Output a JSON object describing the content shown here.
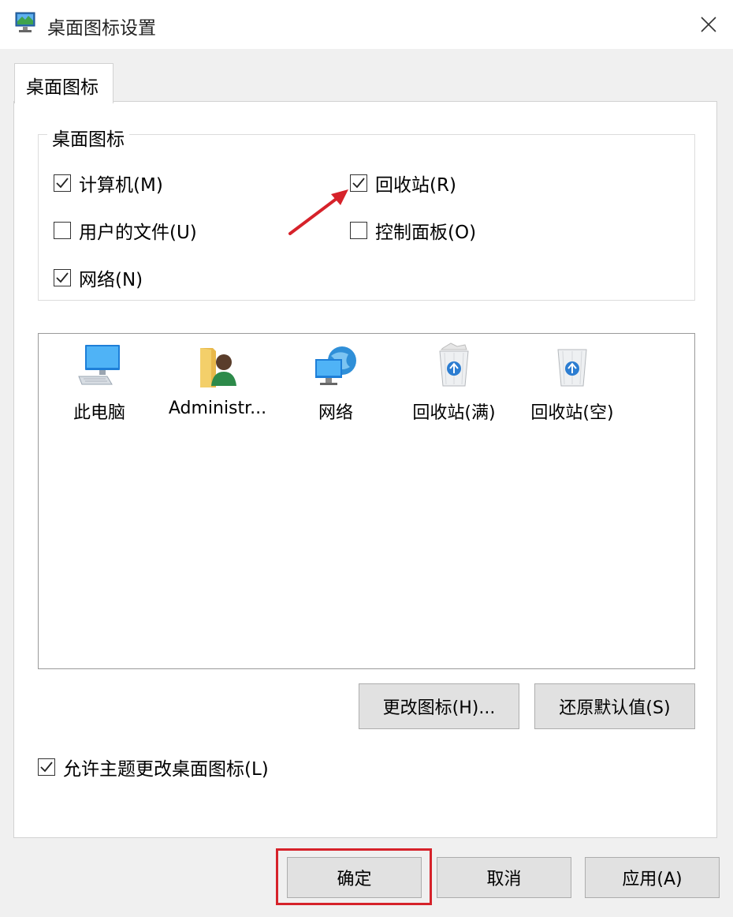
{
  "window": {
    "title": "桌面图标设置",
    "close_icon": "close-icon"
  },
  "tab": {
    "label": "桌面图标"
  },
  "group": {
    "title": "桌面图标",
    "checkboxes": [
      {
        "label": "计算机(M)",
        "checked": true
      },
      {
        "label": "回收站(R)",
        "checked": true
      },
      {
        "label": "用户的文件(U)",
        "checked": false
      },
      {
        "label": "控制面板(O)",
        "checked": false
      },
      {
        "label": "网络(N)",
        "checked": true
      }
    ]
  },
  "icons": [
    {
      "label": "此电脑",
      "icon": "computer-icon"
    },
    {
      "label": "Administr...",
      "icon": "user-folder-icon"
    },
    {
      "label": "网络",
      "icon": "network-icon"
    },
    {
      "label": "回收站(满)",
      "icon": "recycle-bin-full-icon"
    },
    {
      "label": "回收站(空)",
      "icon": "recycle-bin-empty-icon"
    }
  ],
  "buttons": {
    "change_icon": "更改图标(H)...",
    "restore_default": "还原默认值(S)",
    "ok": "确定",
    "cancel": "取消",
    "apply": "应用(A)"
  },
  "allow_themes": {
    "label": "允许主题更改桌面图标(L)",
    "checked": true
  },
  "colors": {
    "highlight": "#d6222a",
    "arrow": "#d6222a",
    "accent": "#0078d7"
  }
}
